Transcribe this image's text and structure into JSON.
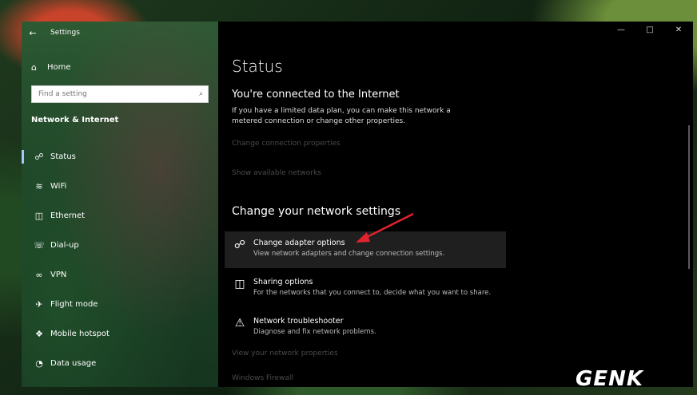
{
  "window": {
    "title": "Settings"
  },
  "sidebar": {
    "home": "Home",
    "search_placeholder": "Find a setting",
    "section": "Network & Internet",
    "items": [
      {
        "label": "Status",
        "icon": "globe-icon",
        "active": true
      },
      {
        "label": "WiFi",
        "icon": "wifi-icon"
      },
      {
        "label": "Ethernet",
        "icon": "ethernet-icon"
      },
      {
        "label": "Dial-up",
        "icon": "dialup-icon"
      },
      {
        "label": "VPN",
        "icon": "vpn-icon"
      },
      {
        "label": "Flight mode",
        "icon": "airplane-icon"
      },
      {
        "label": "Mobile hotspot",
        "icon": "hotspot-icon"
      },
      {
        "label": "Data usage",
        "icon": "data-usage-icon"
      }
    ]
  },
  "main": {
    "title": "Status",
    "connection": {
      "title": "You're connected to the Internet",
      "description": "If you have a limited data plan, you can make this network a metered connection or change other properties."
    },
    "links": {
      "change_connection": "Change connection properties",
      "show_networks": "Show available networks",
      "view_properties": "View your network properties",
      "firewall": "Windows Firewall"
    },
    "change_section": "Change your network settings",
    "options": [
      {
        "name": "Change adapter options",
        "desc": "View network adapters and change connection settings.",
        "icon": "adapter-icon"
      },
      {
        "name": "Sharing options",
        "desc": "For the networks that you connect to, decide what you want to share.",
        "icon": "sharing-icon"
      },
      {
        "name": "Network troubleshooter",
        "desc": "Diagnose and fix network problems.",
        "icon": "warning-icon"
      }
    ]
  },
  "watermark": "GENK",
  "colors": {
    "accent": "#9fc9ff",
    "arrow": "#e0232e",
    "highlight": "#1f1f1f"
  }
}
